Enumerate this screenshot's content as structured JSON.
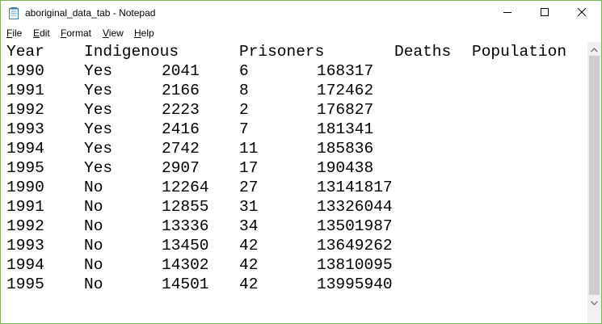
{
  "window": {
    "title": "aboriginal_data_tab - Notepad"
  },
  "menu": {
    "file": {
      "underlined": "F",
      "rest": "ile"
    },
    "edit": {
      "underlined": "E",
      "rest": "dit"
    },
    "format": {
      "underlined": "F",
      "rest": "ormat"
    },
    "view": {
      "underlined": "V",
      "rest": "iew"
    },
    "help": {
      "underlined": "H",
      "rest": "elp"
    }
  },
  "icons": {
    "app": "notepad-icon",
    "minimize": "minimize-icon",
    "maximize": "maximize-icon",
    "close": "close-icon",
    "scroll_up": "chevron-up-icon",
    "scroll_down": "chevron-down-icon"
  },
  "colors": {
    "window_border": "#78b45a",
    "scrollbar_track": "#f0f0f0",
    "scrollbar_thumb": "#cdcdcd"
  },
  "document": {
    "header": [
      "Year",
      "Indigenous",
      "Prisoners",
      "Deaths",
      "Population"
    ],
    "rows": [
      [
        "1990",
        "Yes",
        "2041",
        "6",
        "168317"
      ],
      [
        "1991",
        "Yes",
        "2166",
        "8",
        "172462"
      ],
      [
        "1992",
        "Yes",
        "2223",
        "2",
        "176827"
      ],
      [
        "1993",
        "Yes",
        "2416",
        "7",
        "181341"
      ],
      [
        "1994",
        "Yes",
        "2742",
        "11",
        "185836"
      ],
      [
        "1995",
        "Yes",
        "2907",
        "17",
        "190438"
      ],
      [
        "1990",
        "No",
        "12264",
        "27",
        "13141817"
      ],
      [
        "1991",
        "No",
        "12855",
        "31",
        "13326044"
      ],
      [
        "1992",
        "No",
        "13336",
        "34",
        "13501987"
      ],
      [
        "1993",
        "No",
        "13450",
        "42",
        "13649262"
      ],
      [
        "1994",
        "No",
        "14302",
        "42",
        "13810095"
      ],
      [
        "1995",
        "No",
        "14501",
        "42",
        "13995940"
      ]
    ]
  }
}
